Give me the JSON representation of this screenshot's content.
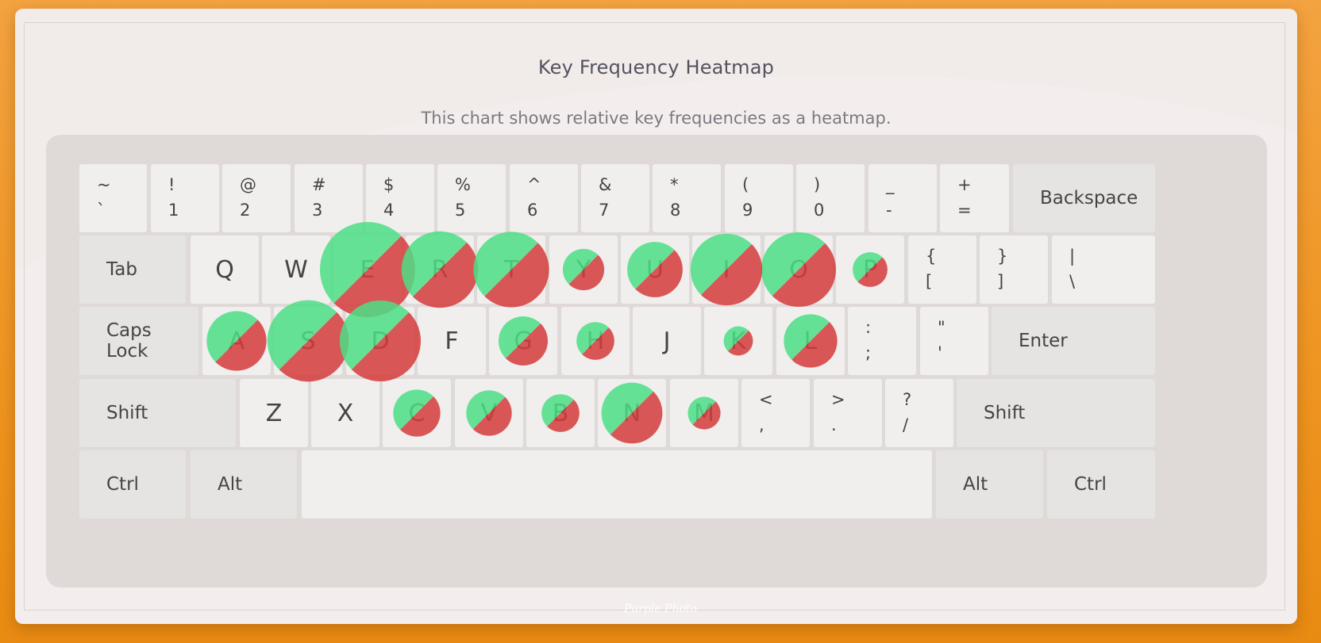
{
  "title": "Key Frequency Heatmap",
  "subtitle": "This chart shows relative key frequencies as a heatmap.",
  "watermark": "Purple Photo",
  "colors": {
    "low": "#4ddf86",
    "high": "#d63c3c"
  },
  "rows": [
    [
      {
        "top": "~",
        "bot": "`"
      },
      {
        "top": "!",
        "bot": "1"
      },
      {
        "top": "@",
        "bot": "2"
      },
      {
        "top": "#",
        "bot": "3"
      },
      {
        "top": "$",
        "bot": "4"
      },
      {
        "top": "%",
        "bot": "5"
      },
      {
        "top": "^",
        "bot": "6"
      },
      {
        "top": "&",
        "bot": "7"
      },
      {
        "top": "*",
        "bot": "8"
      },
      {
        "top": "(",
        "bot": "9"
      },
      {
        "top": ")",
        "bot": "0"
      },
      {
        "top": "_",
        "bot": "-"
      },
      {
        "top": "+",
        "bot": "="
      },
      {
        "mod": "Backspace"
      }
    ],
    [
      {
        "mod": "Tab"
      },
      {
        "label": "Q"
      },
      {
        "label": "W"
      },
      {
        "label": "E"
      },
      {
        "label": "R"
      },
      {
        "label": "T"
      },
      {
        "label": "Y"
      },
      {
        "label": "U"
      },
      {
        "label": "I"
      },
      {
        "label": "O"
      },
      {
        "label": "P"
      },
      {
        "top": "{",
        "bot": "["
      },
      {
        "top": "}",
        "bot": "]"
      },
      {
        "top": "|",
        "bot": "\\"
      }
    ],
    [
      {
        "mod": "Caps Lock"
      },
      {
        "label": "A"
      },
      {
        "label": "S"
      },
      {
        "label": "D"
      },
      {
        "label": "F"
      },
      {
        "label": "G"
      },
      {
        "label": "H"
      },
      {
        "label": "J"
      },
      {
        "label": "K"
      },
      {
        "label": "L"
      },
      {
        "top": ":",
        "bot": ";"
      },
      {
        "top": "\"",
        "bot": "'"
      },
      {
        "mod": "Enter"
      }
    ],
    [
      {
        "mod": "Shift"
      },
      {
        "label": "Z"
      },
      {
        "label": "X"
      },
      {
        "label": "C"
      },
      {
        "label": "V"
      },
      {
        "label": "B"
      },
      {
        "label": "N"
      },
      {
        "label": "M"
      },
      {
        "top": "<",
        "bot": ","
      },
      {
        "top": ">",
        "bot": "."
      },
      {
        "top": "?",
        "bot": "/"
      },
      {
        "mod": "Shift"
      }
    ],
    [
      {
        "mod": "Ctrl"
      },
      {
        "mod": "Alt"
      },
      {
        "space": ""
      },
      {
        "mod": "Alt"
      },
      {
        "mod": "Ctrl"
      }
    ]
  ],
  "chart_data": {
    "type": "heatmap",
    "title": "Key Frequency Heatmap",
    "subtitle": "This chart shows relative key frequencies as a heatmap.",
    "frequencies": {
      "E": 12.7,
      "S": 9.3,
      "D": 9.2,
      "R": 8.2,
      "T": 8.0,
      "O": 7.8,
      "I": 7.2,
      "N": 5.2,
      "A": 5.0,
      "U": 4.3,
      "L": 4.0,
      "G": 3.4,
      "C": 3.1,
      "V": 2.9,
      "Y": 2.4,
      "H": 2.0,
      "B": 2.0,
      "P": 1.7,
      "M": 1.5,
      "K": 1.2,
      "Q": 0,
      "W": 0,
      "F": 0,
      "J": 0,
      "Z": 0,
      "X": 0
    }
  }
}
